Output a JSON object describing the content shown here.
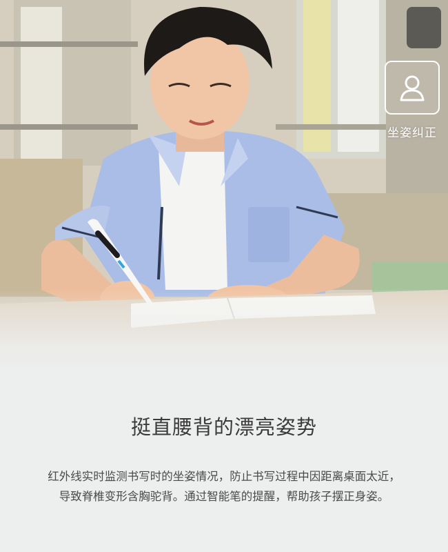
{
  "badge": {
    "icon": "person-icon",
    "label": "坐姿纠正",
    "color": "#ffffff"
  },
  "headline": "挺直腰背的漂亮姿势",
  "description": [
    "红外线实时监测书写时的坐姿情况，防止书写过程中因距离桌面太近，",
    "导致脊椎变形含胸驼背。通过智能笔的提醒，帮助孩子摆正身姿。"
  ],
  "colors": {
    "background": "#edefee",
    "text": "#3a3a3a",
    "shirt": "#a9bde6"
  }
}
